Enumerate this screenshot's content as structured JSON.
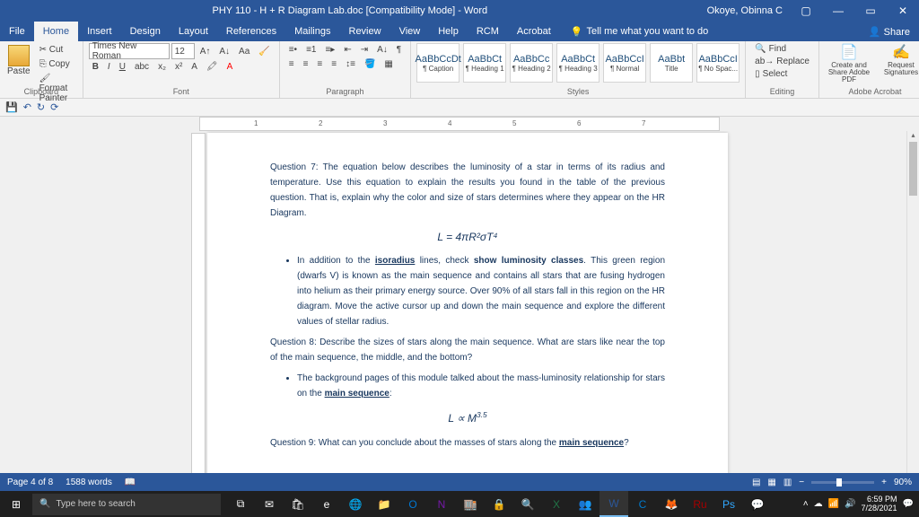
{
  "window": {
    "title": "PHY 110 - H + R Diagram Lab.doc [Compatibility Mode] - Word",
    "user": "Okoye, Obinna C"
  },
  "menu": {
    "tabs": [
      "File",
      "Home",
      "Insert",
      "Design",
      "Layout",
      "References",
      "Mailings",
      "Review",
      "View",
      "Help",
      "RCM",
      "Acrobat"
    ],
    "tellme": "Tell me what you want to do",
    "share": "Share"
  },
  "ribbon": {
    "clipboard": {
      "label": "Clipboard",
      "paste": "Paste",
      "cut": "Cut",
      "copy": "Copy",
      "painter": "Format Painter"
    },
    "font": {
      "label": "Font",
      "name": "Times New Roman",
      "size": "12"
    },
    "paragraph": {
      "label": "Paragraph"
    },
    "styles": {
      "label": "Styles",
      "items": [
        {
          "sample": "AaBbCcDt",
          "name": "¶ Caption"
        },
        {
          "sample": "AaBbCt",
          "name": "¶ Heading 1"
        },
        {
          "sample": "AaBbCc",
          "name": "¶ Heading 2"
        },
        {
          "sample": "AaBbCt",
          "name": "¶ Heading 3"
        },
        {
          "sample": "AaBbCcI",
          "name": "¶ Normal"
        },
        {
          "sample": "AaBbt",
          "name": "Title"
        },
        {
          "sample": "AaBbCcI",
          "name": "¶ No Spac..."
        }
      ]
    },
    "editing": {
      "label": "Editing",
      "find": "Find",
      "replace": "Replace",
      "select": "Select"
    },
    "adobe": {
      "label": "Adobe Acrobat",
      "create": "Create and Share Adobe PDF",
      "request": "Request Signatures"
    }
  },
  "doc": {
    "q7": "Question 7: The equation below describes the luminosity of a star in terms of its radius and temperature.  Use this equation to explain the results you found in the table of the previous question.  That is, explain why the color and size of stars determines where they appear on the HR Diagram.",
    "eq1": "L = 4πR²σT⁴",
    "bullet1a": "In addition to the ",
    "bullet1_iso": "isoradius",
    "bullet1b": " lines, check ",
    "bullet1_show": "show luminosity classes",
    "bullet1c": ".  This green region (dwarfs V) is known as the main sequence and contains all stars that are fusing hydrogen into helium as their primary energy source.  Over 90% of all stars fall in this region on the HR diagram.  Move the active cursor up and down the main sequence and explore the different values of stellar radius.",
    "q8": "Question 8: Describe the sizes of stars along the main sequence.  What are stars like near the top of the main sequence, the middle, and the bottom?",
    "bullet2a": "The background pages of this module talked about the mass-luminosity relationship for stars on the ",
    "bullet2_ms": "main sequence",
    "bullet2b": ":",
    "eq2_l": "L ∝ M",
    "eq2_exp": "3.5",
    "q9a": "Question 9:  What can you conclude about the masses of stars along the ",
    "q9_ms": "main sequence",
    "q9b": "?"
  },
  "status": {
    "page": "Page 4 of 8",
    "words": "1588 words",
    "zoom": "90%"
  },
  "taskbar": {
    "search": "Type here to search",
    "time": "6:59 PM",
    "date": "7/28/2021"
  },
  "ruler_ticks": [
    "1",
    "2",
    "3",
    "4",
    "5",
    "6",
    "7"
  ]
}
